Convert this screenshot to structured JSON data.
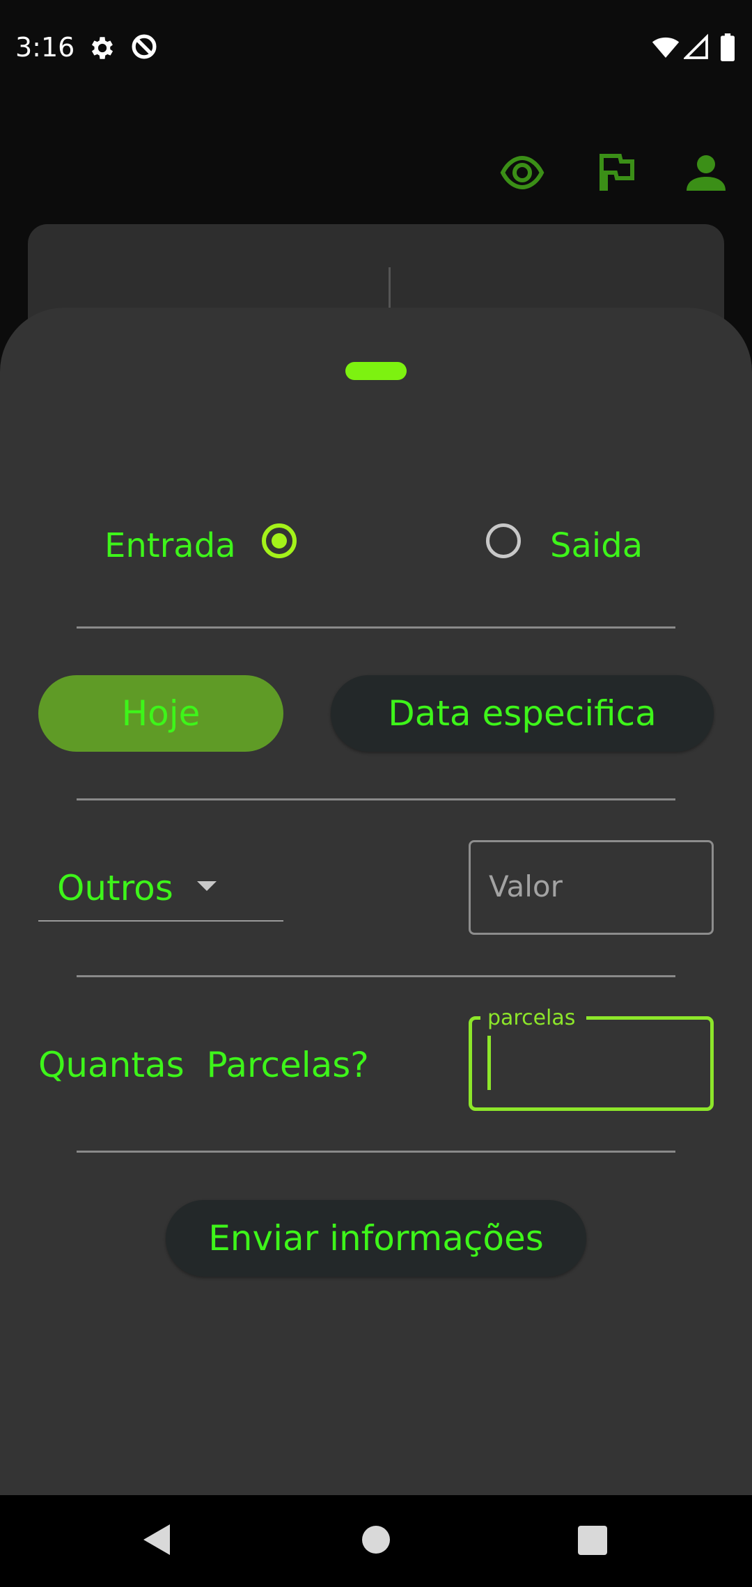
{
  "status_bar": {
    "time": "3:16",
    "icons": [
      "gear-icon",
      "data-saver-icon",
      "wifi-icon",
      "signal-icon",
      "battery-icon"
    ]
  },
  "top_bar": {
    "icons": [
      "eye-icon",
      "flag-icon",
      "person-icon"
    ],
    "icon_color": "#3b8f17"
  },
  "sheet": {
    "type_options": {
      "entrada_label": "Entrada",
      "saida_label": "Saida",
      "selected": "Entrada"
    },
    "date_buttons": {
      "hoje_label": "Hoje",
      "data_especifica_label": "Data especifica",
      "selected": "Hoje"
    },
    "category": {
      "selected": "Outros"
    },
    "valor": {
      "placeholder": "Valor",
      "value": ""
    },
    "parcelas": {
      "question": "Quantas  Parcelas?",
      "label": "parcelas",
      "value": ""
    },
    "submit_label": "Enviar informações"
  },
  "colors": {
    "accent_green": "#3ef51a",
    "handle_green": "#7df210",
    "selected_button": "#5f9b26",
    "sheet_background": "#343434"
  },
  "nav_bar": {
    "icons": [
      "nav-back-icon",
      "nav-home-icon",
      "nav-recents-icon"
    ]
  }
}
